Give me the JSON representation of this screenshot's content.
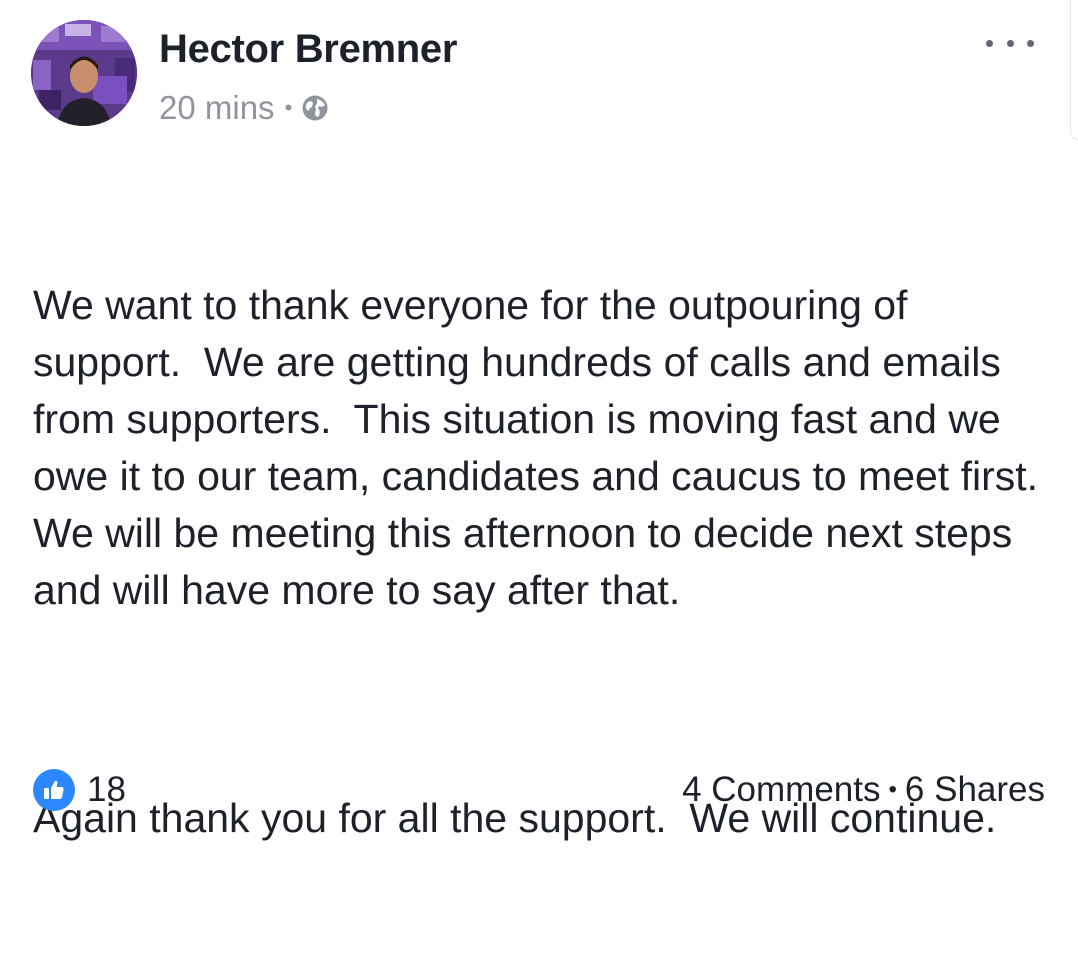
{
  "post": {
    "author": "Hector Bremner",
    "timestamp": "20 mins",
    "meta_separator": "•",
    "privacy_icon": "globe-icon",
    "more_icon": "more-horizontal-icon",
    "paragraphs": [
      "We want to thank everyone for the outpouring of support.  We are getting hundreds of calls and emails from supporters.  This situation is moving fast and we owe it to our team, candidates and caucus to meet first.  We will be meeting this afternoon to decide next steps and will have more to say after that.",
      "Again thank you for all the support.  We will continue."
    ]
  },
  "reactions": {
    "icon": "like-icon",
    "count": "18"
  },
  "engagement": {
    "comments": "4 Comments",
    "separator": "•",
    "shares": "6 Shares"
  },
  "colors": {
    "text": "#1d2129",
    "meta": "#90949c",
    "like_blue": "#2d88ff",
    "avatar_purple": "#6a3fa0"
  }
}
